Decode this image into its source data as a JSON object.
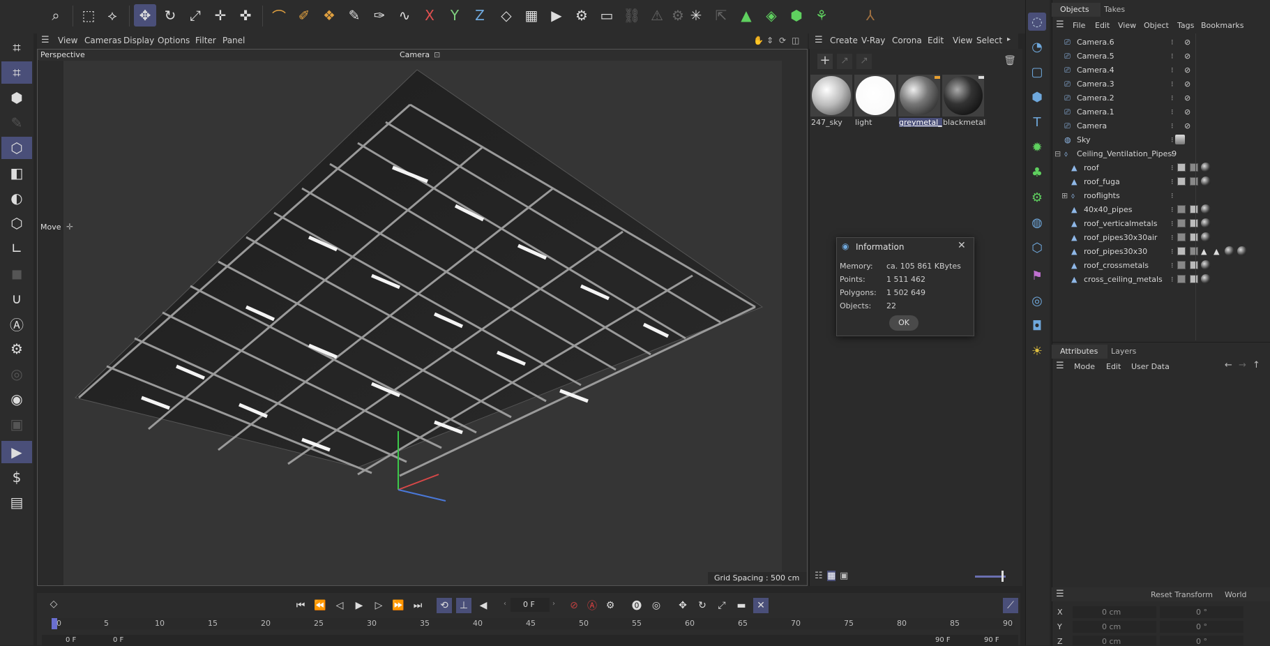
{
  "viewport": {
    "menu": [
      "View",
      "Cameras",
      "Display",
      "Options",
      "Filter",
      "Panel"
    ],
    "view_name": "Perspective",
    "camera_label": "Camera",
    "tool_label": "Move",
    "grid_spacing": "Grid Spacing : 500 cm"
  },
  "materials": {
    "menu": [
      "Create",
      "V-Ray",
      "Corona",
      "Edit",
      "View",
      "Select"
    ],
    "items": [
      {
        "label": "247_sky"
      },
      {
        "label": "light"
      },
      {
        "label": "greymetal_p"
      },
      {
        "label": "blackmetalP"
      }
    ]
  },
  "objects_panel": {
    "tabs": [
      "Objects",
      "Takes"
    ],
    "menu": [
      "File",
      "Edit",
      "View",
      "Object",
      "Tags",
      "Bookmarks"
    ],
    "rows": [
      {
        "name": "Camera.6"
      },
      {
        "name": "Camera.5"
      },
      {
        "name": "Camera.4"
      },
      {
        "name": "Camera.3"
      },
      {
        "name": "Camera.2"
      },
      {
        "name": "Camera.1"
      },
      {
        "name": "Camera"
      },
      {
        "name": "Sky"
      },
      {
        "name": "Ceiling_Ventilation_Pipes9"
      },
      {
        "name": "roof"
      },
      {
        "name": "roof_fuga"
      },
      {
        "name": "rooflights"
      },
      {
        "name": "40x40_pipes"
      },
      {
        "name": "roof_verticalmetals"
      },
      {
        "name": "roof_pipes30x30air"
      },
      {
        "name": "roof_pipes30x30"
      },
      {
        "name": "roof_crossmetals"
      },
      {
        "name": "cross_ceiling_metals"
      }
    ]
  },
  "attributes_panel": {
    "tabs": [
      "Attributes",
      "Layers"
    ],
    "menu": [
      "Mode",
      "Edit",
      "User Data"
    ],
    "reset_transform": "Reset Transform",
    "world": "World",
    "coords": [
      {
        "axis": "X",
        "pos": "0 cm",
        "rot": "0 °"
      },
      {
        "axis": "Y",
        "pos": "0 cm",
        "rot": "0 °"
      },
      {
        "axis": "Z",
        "pos": "0 cm",
        "rot": "0 °"
      }
    ]
  },
  "info_dialog": {
    "title": "Information",
    "rows": [
      {
        "label": "Memory:",
        "value": "ca. 105 861 KBytes"
      },
      {
        "label": "Points:",
        "value": "1 511 462"
      },
      {
        "label": "Polygons:",
        "value": "1 502 649"
      },
      {
        "label": "Objects:",
        "value": "22"
      }
    ],
    "ok_label": "OK"
  },
  "timeline": {
    "current_frame": "0 F",
    "ticks": [
      "0",
      "5",
      "10",
      "15",
      "20",
      "25",
      "30",
      "35",
      "40",
      "45",
      "50",
      "55",
      "60",
      "65",
      "70",
      "75",
      "80",
      "85",
      "90"
    ],
    "start_field": "0 F",
    "start_field2": "0 F",
    "end_field": "90 F",
    "end_field2": "90 F"
  },
  "colors": {
    "accent": "#4a4f79",
    "panel_bg": "#2b2b2b",
    "viewport_bg": "#353535",
    "icon_blue": "#6fa8dc",
    "icon_green": "#5fd05f"
  }
}
